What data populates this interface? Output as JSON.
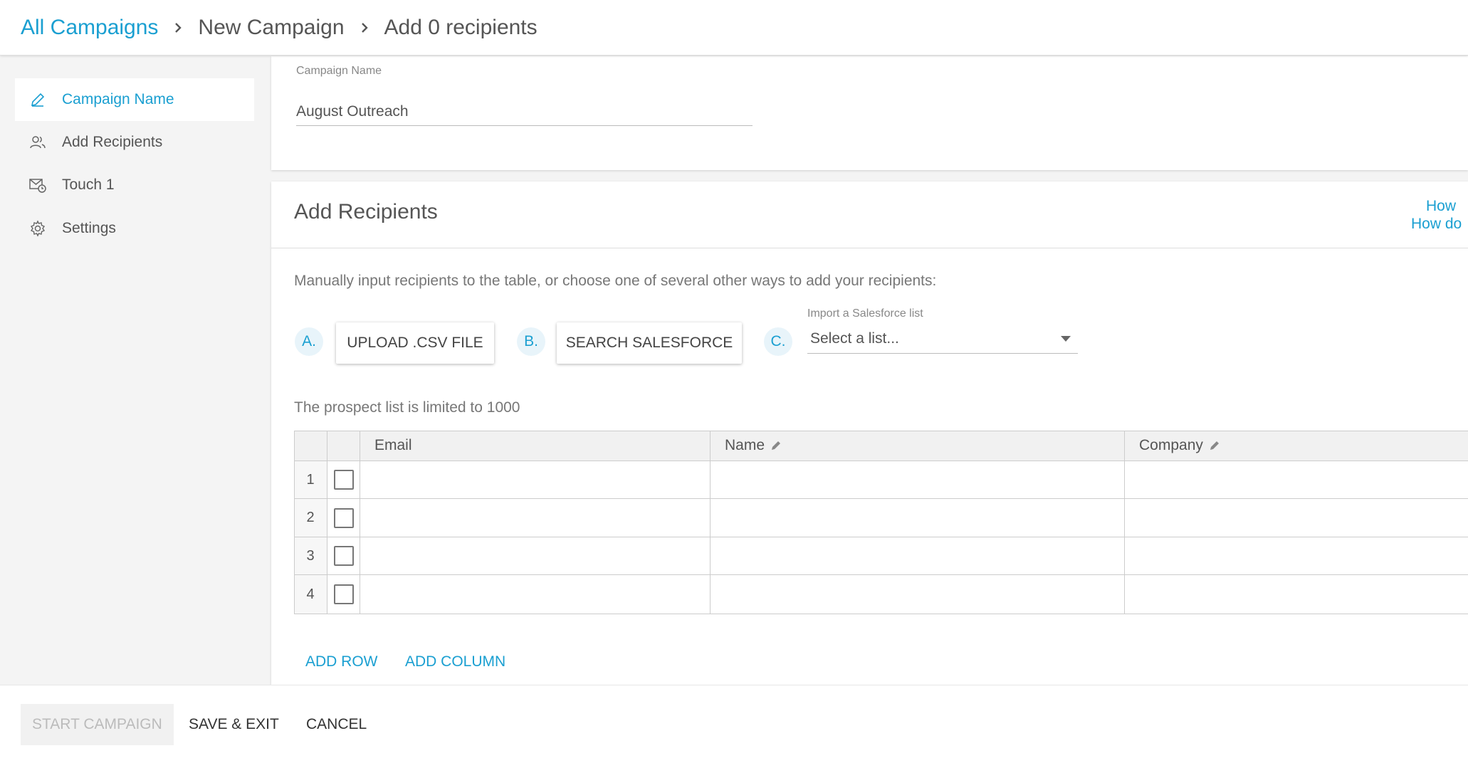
{
  "breadcrumb": {
    "items": [
      "All Campaigns",
      "New Campaign",
      "Add 0 recipients"
    ]
  },
  "sidebar": {
    "items": [
      {
        "label": "Campaign Name",
        "icon": "pencil-icon",
        "active": true
      },
      {
        "label": "Add Recipients",
        "icon": "users-icon",
        "active": false
      },
      {
        "label": "Touch 1",
        "icon": "mail-clock-icon",
        "active": false
      },
      {
        "label": "Settings",
        "icon": "gear-icon",
        "active": false
      }
    ]
  },
  "campaign": {
    "name_label": "Campaign Name",
    "name_value": "August Outreach"
  },
  "recipients": {
    "title": "Add Recipients",
    "help_links": [
      "How",
      "How do"
    ],
    "instructions": "Manually input recipients to the table, or choose one of several other ways to add your recipients:",
    "options": {
      "a_badge": "A.",
      "a_button": "UPLOAD .CSV FILE",
      "b_badge": "B.",
      "b_button": "SEARCH SALESFORCE",
      "c_badge": "C.",
      "c_label": "Import a Salesforce list",
      "c_placeholder": "Select a list..."
    },
    "limit_text": "The prospect list is limited to 1000",
    "table": {
      "columns": [
        "Email",
        "Name",
        "Company"
      ],
      "rows": [
        "1",
        "2",
        "3",
        "4"
      ]
    },
    "add_row": "ADD ROW",
    "add_column": "ADD COLUMN"
  },
  "footer": {
    "start": "START CAMPAIGN",
    "save_exit": "SAVE & EXIT",
    "cancel": "CANCEL"
  },
  "colors": {
    "accent": "#1a9fd1",
    "background": "#f4f4f4"
  }
}
